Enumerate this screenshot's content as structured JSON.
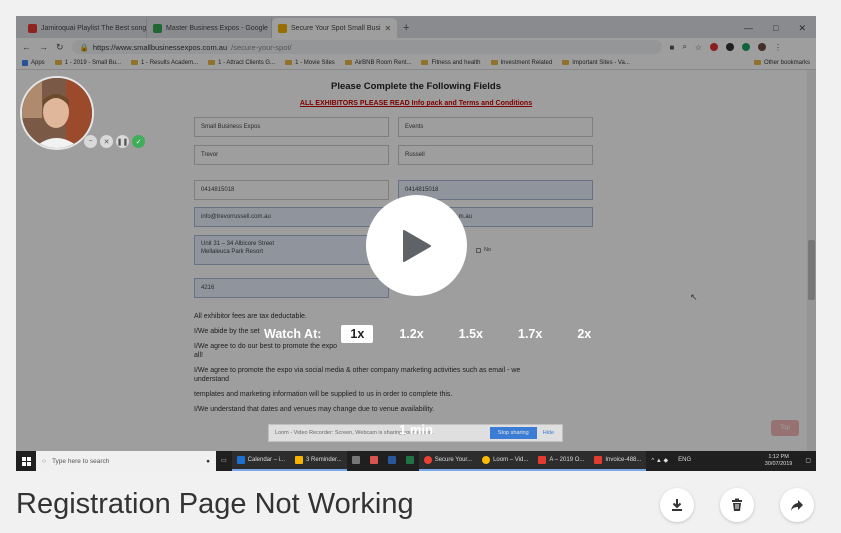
{
  "video": {
    "browser": {
      "tabs": [
        {
          "title": "Jamiroquai Playlist The Best song",
          "icon_color": "#e53935",
          "active": false
        },
        {
          "title": "Master Business Expos - Google",
          "icon_color": "#34a853",
          "active": false
        },
        {
          "title": "Secure Your Spot Small Busi",
          "icon_color": "#f4b400",
          "active": true
        }
      ],
      "url_host": "https://www.smallbusinessexpos.com.au",
      "url_path": "/secure-your-spot/",
      "bookmarks": [
        "Apps",
        "1 - 2019 - Small Bu...",
        "1 - Results Academ...",
        "1 - Attract Clients G...",
        "1 - Movie Sites",
        "AirBNB Room Rent...",
        "Fitness and health",
        "Investment Related",
        "Important Sites - Va...",
        "Other bookmarks"
      ]
    },
    "form": {
      "heading": "Please Complete the Following Fields",
      "notice": "ALL EXHIBITORS PLEASE READ Info pack and Terms and Conditions",
      "fields": {
        "company": "Small Business Expos",
        "events": "Events",
        "first_name": "Trevor",
        "last_name": "Russell",
        "phone": "0414815018",
        "mobile": "0414815018",
        "email": "info@trevorrussell.com.au",
        "email_confirm": "m.au",
        "address_line1": "Unit 31 – 34 Albicore Street",
        "address_line2": "Mellaleuca Park Resort",
        "postcode": "4216"
      },
      "radio_no": "No",
      "lines": [
        "All exhibitor fees are tax deductable.",
        "I/We abide by the set",
        "I/We agree to do our best to promote the expo",
        "all!",
        "I/We agree to promote the expo via social media & other company marketing activities such as email - we understand",
        "templates and marketing information will be supplied to us in order to complete this.",
        "I/We understand that dates and venues may change due to venue availability."
      ],
      "top_button": "Top"
    },
    "speed_label": "Watch At:",
    "speed_options": [
      "1x",
      "1.2x",
      "1.5x",
      "1.7x",
      "2x"
    ],
    "speed_selected": "1x",
    "duration": "1 min",
    "loom_bar": {
      "text": "Loom - Video Recorder: Screen, Webcam is sharing your screen.",
      "share_label": "Stop sharing",
      "hide_label": "Hide"
    },
    "taskbar": {
      "search_placeholder": "Type here to search",
      "items": [
        "Calendar – i...",
        "3 Reminder...",
        "Secure Your...",
        "Loom – Vid...",
        "A – 2019 O...",
        "Invoice-488..."
      ],
      "lang": "ENG",
      "time": "1:12 PM",
      "date": "30/07/2019"
    }
  },
  "video_title": "Registration Page Not Working",
  "actions": {
    "download": "download-icon",
    "delete": "trash-icon",
    "share": "share-icon"
  },
  "colors": {
    "play_icon": "#5f6368",
    "title_text": "#333333",
    "notice_red": "#cc0000"
  }
}
